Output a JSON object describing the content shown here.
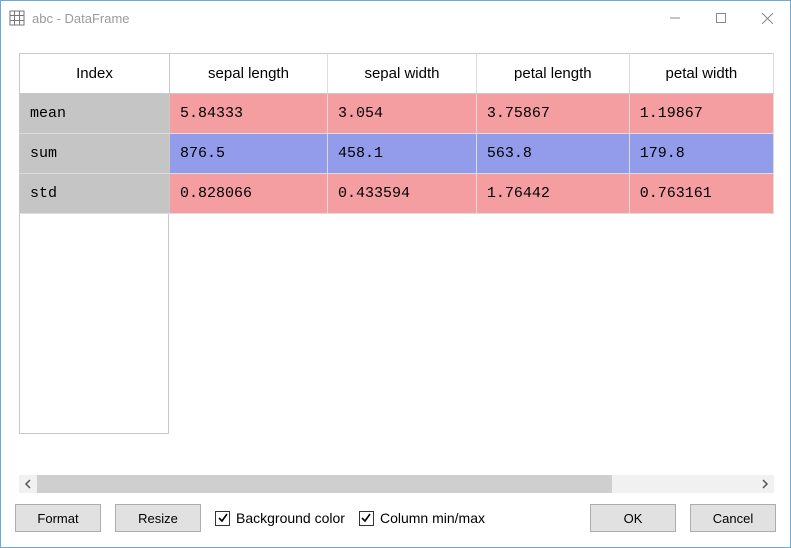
{
  "window": {
    "title": "abc - DataFrame"
  },
  "table": {
    "index_header": "Index",
    "columns": [
      "sepal length",
      "sepal width",
      "petal length",
      "petal width"
    ],
    "rows": [
      {
        "index": "mean",
        "color": "pink",
        "values": [
          "5.84333",
          "3.054",
          "3.75867",
          "1.19867"
        ]
      },
      {
        "index": "sum",
        "color": "blue",
        "values": [
          "876.5",
          "458.1",
          "563.8",
          "179.8"
        ]
      },
      {
        "index": "std",
        "color": "pink",
        "values": [
          "0.828066",
          "0.433594",
          "1.76442",
          "0.763161"
        ]
      }
    ]
  },
  "footer": {
    "format_label": "Format",
    "resize_label": "Resize",
    "bg_color_label": "Background color",
    "bg_color_checked": true,
    "col_minmax_label": "Column min/max",
    "col_minmax_checked": true,
    "ok_label": "OK",
    "cancel_label": "Cancel"
  },
  "chart_data": {
    "type": "table",
    "title": "abc - DataFrame",
    "columns": [
      "sepal length",
      "sepal width",
      "petal length",
      "petal width"
    ],
    "index": [
      "mean",
      "sum",
      "std"
    ],
    "data": [
      [
        5.84333,
        3.054,
        3.75867,
        1.19867
      ],
      [
        876.5,
        458.1,
        563.8,
        179.8
      ],
      [
        0.828066,
        0.433594,
        1.76442,
        0.763161
      ]
    ]
  }
}
